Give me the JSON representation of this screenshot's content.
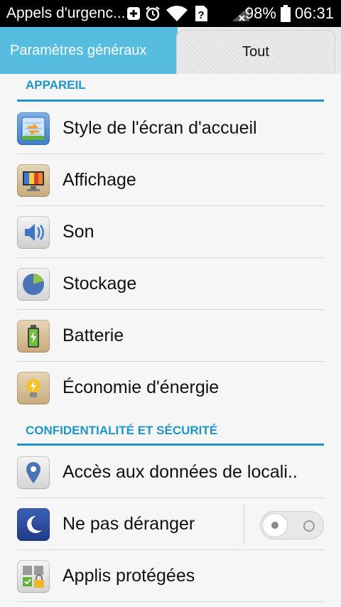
{
  "status_bar": {
    "carrier_text": "Appels d'urgenc...",
    "battery_percent": "98%",
    "time": "06:31",
    "icons": [
      "add-box-icon",
      "alarm-icon",
      "wifi-icon",
      "sim-unknown-icon",
      "signal-no-icon",
      "battery-icon"
    ]
  },
  "tabs": [
    {
      "label": "Paramètres généraux",
      "active": true
    },
    {
      "label": "Tout",
      "active": false
    }
  ],
  "sections": [
    {
      "title": "APPAREIL",
      "items": [
        {
          "label": "Style de l'écran d'accueil",
          "icon": "home-screen-style-icon"
        },
        {
          "label": "Affichage",
          "icon": "display-icon"
        },
        {
          "label": "Son",
          "icon": "sound-icon"
        },
        {
          "label": "Stockage",
          "icon": "storage-icon"
        },
        {
          "label": "Batterie",
          "icon": "battery-icon"
        },
        {
          "label": "Économie d'énergie",
          "icon": "power-saving-icon"
        }
      ]
    },
    {
      "title": "CONFIDENTIALITÉ ET SÉCURITÉ",
      "items": [
        {
          "label": "Accès aux données de locali..",
          "icon": "location-icon"
        },
        {
          "label": "Ne pas déranger",
          "icon": "moon-icon",
          "toggle": false
        },
        {
          "label": "Applis protégées",
          "icon": "protected-apps-icon"
        }
      ]
    }
  ],
  "colors": {
    "accent": "#1f95c9",
    "tab_active": "#57bde0"
  }
}
